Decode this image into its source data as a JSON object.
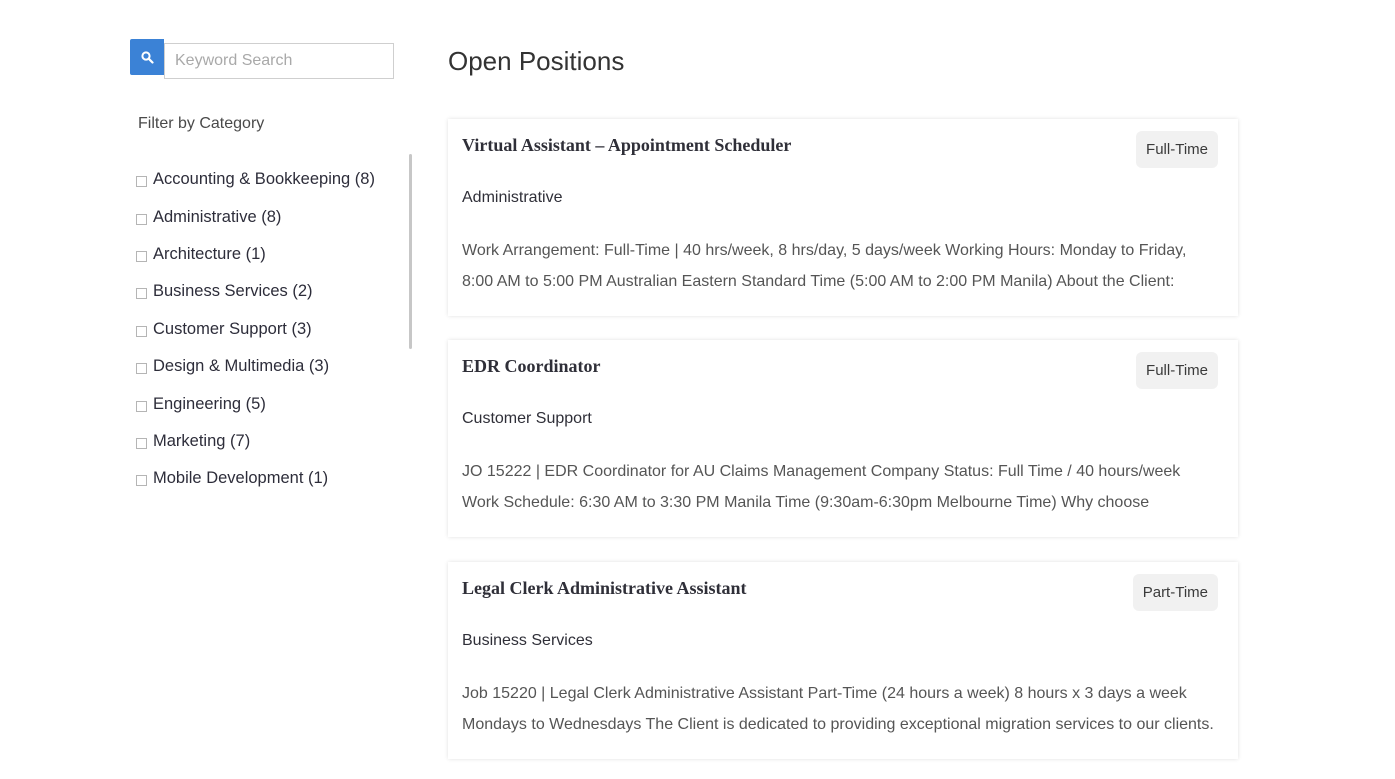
{
  "search": {
    "placeholder": "Keyword Search",
    "button_icon": "search-icon",
    "button_color": "#3b82d6"
  },
  "sidebar": {
    "filter_title": "Filter by Category",
    "categories": [
      {
        "label": "Accounting & Bookkeeping (8)"
      },
      {
        "label": "Administrative (8)"
      },
      {
        "label": "Architecture (1)"
      },
      {
        "label": "Business Services (2)"
      },
      {
        "label": "Customer Support (3)"
      },
      {
        "label": "Design & Multimedia (3)"
      },
      {
        "label": "Engineering (5)"
      },
      {
        "label": "Marketing (7)"
      },
      {
        "label": "Mobile Development (1)"
      }
    ]
  },
  "main": {
    "title": "Open Positions",
    "jobs": [
      {
        "title": "Virtual Assistant – Appointment Scheduler",
        "type": "Full-Time",
        "category": "Administrative",
        "description_line1": "Work Arrangement:  Full-Time | 40 hrs/week, 8 hrs/day, 5 days/week Working Hours:  Monday to Friday,",
        "description_line2": "8:00 AM to 5:00 PM Australian Eastern Standard Time (5:00 AM to 2:00 PM Manila) About the Client:"
      },
      {
        "title": "EDR Coordinator",
        "type": "Full-Time",
        "category": "Customer Support",
        "description_line1": "JO  15222 | EDR Coordinator  for AU Claims Management Company Status:  Full Time / 40 hours/week",
        "description_line2": "Work Schedule:  6:30 AM to 3:30 PM Manila Time (9:30am-6:30pm Melbourne Time) Why choose"
      },
      {
        "title": "Legal Clerk Administrative Assistant",
        "type": "Part-Time",
        "category": "Business Services",
        "description_line1": "Job 15220 | Legal Clerk Administrative Assistant Part-Time (24 hours a week) 8 hours x 3 days a week",
        "description_line2": "Mondays to Wednesdays The Client is dedicated to providing exceptional migration services to our clients."
      }
    ]
  }
}
